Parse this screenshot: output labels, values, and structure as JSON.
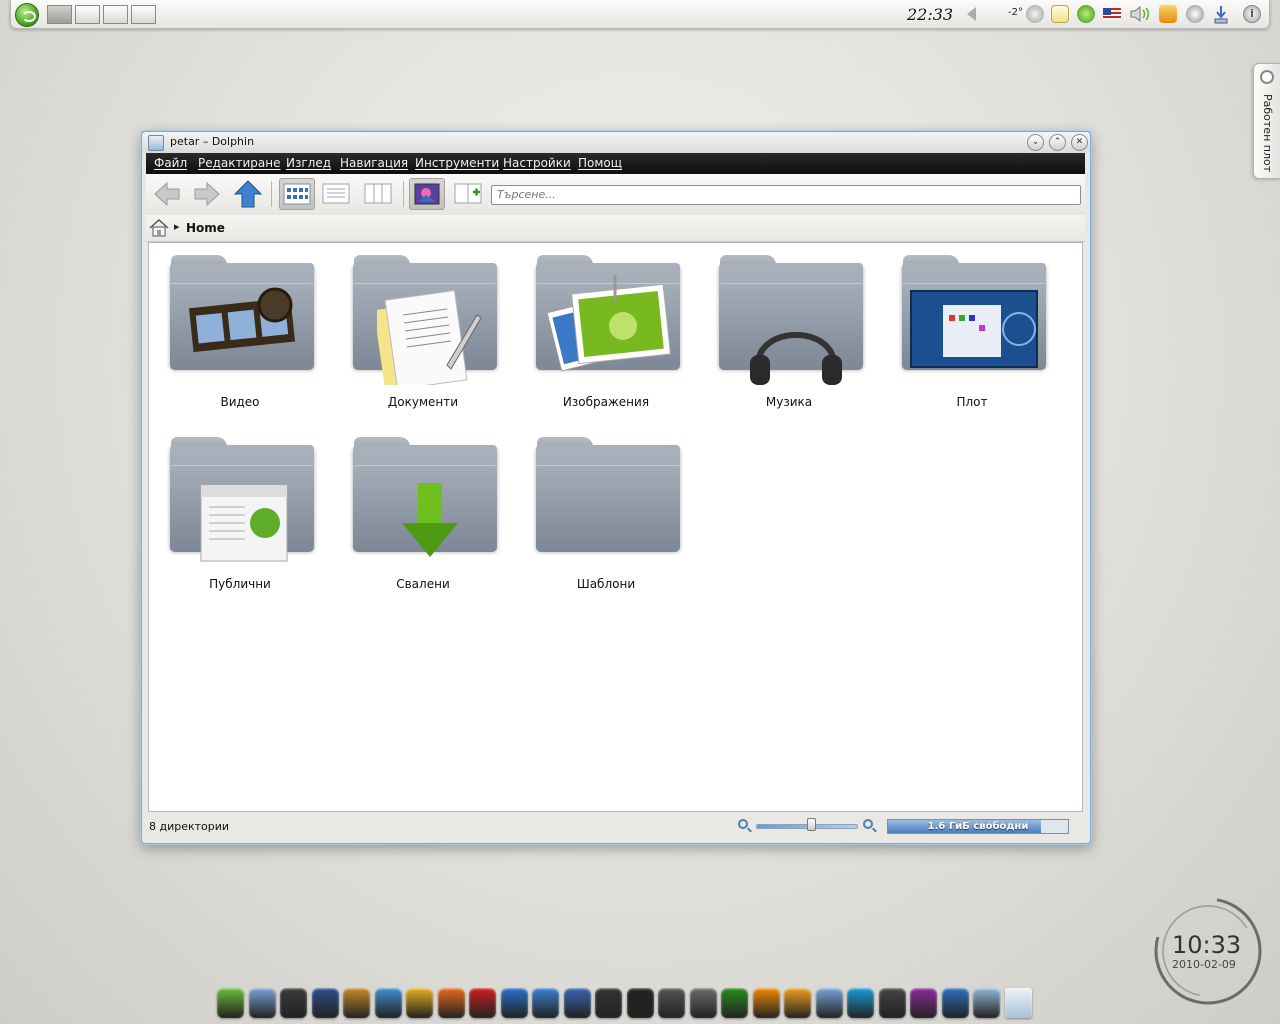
{
  "top_panel": {
    "clock": "22:33",
    "temperature": "-2°",
    "pager_desktops": 4,
    "tray_icons": [
      "weather-icon",
      "notes-icon",
      "suse-updater-icon",
      "flag-us-icon",
      "volume-icon",
      "rss-icon",
      "network-icon",
      "download-icon",
      "info-icon"
    ]
  },
  "toolbox": {
    "label": "Работен плот"
  },
  "window": {
    "title": "petar – Dolphin",
    "menu": [
      "Файл",
      "Редактиране",
      "Изглед",
      "Навигация",
      "Инструменти",
      "Настройки",
      "Помощ"
    ],
    "search_placeholder": "Търсене...",
    "breadcrumb": "Home",
    "items": [
      {
        "label": "Видео",
        "emblem": "film-icon"
      },
      {
        "label": "Документи",
        "emblem": "document-icon"
      },
      {
        "label": "Изображения",
        "emblem": "picture-icon"
      },
      {
        "label": "Музика",
        "emblem": "headphones-icon"
      },
      {
        "label": "Плот",
        "emblem": "desktop-icon"
      },
      {
        "label": "Публични",
        "emblem": "website-icon"
      },
      {
        "label": "Свалени",
        "emblem": "download-arrow-icon"
      },
      {
        "label": "Шаблони",
        "emblem": ""
      }
    ],
    "status": "8 директории",
    "zoom_level": 0.55,
    "free_space": "1.6 ГиБ свободни",
    "free_space_fill": 0.85
  },
  "clock_widget": {
    "time": "10:33",
    "date": "2010-02-09"
  },
  "dock_icons": [
    "suse-home-icon",
    "network-share-icon",
    "terminal-icon",
    "monitor-icon",
    "tools-icon",
    "browser-icon",
    "chrome-icon",
    "firefox-icon",
    "opera-icon",
    "globe-icon",
    "web-icon",
    "kde-icon",
    "camera-icon",
    "movie-clapper-icon",
    "film-strip-icon",
    "scripts-icon",
    "music-player-icon",
    "vlc-icon",
    "rss-reader-icon",
    "download-manager-icon",
    "skype-icon",
    "chat-icon",
    "eye-icon",
    "messenger-icon",
    "glass-icon",
    "trash-icon"
  ],
  "colors": {
    "menubar": "#1a1a1a",
    "window_border": "#79a9d6",
    "accent_green": "#3c9a18"
  }
}
